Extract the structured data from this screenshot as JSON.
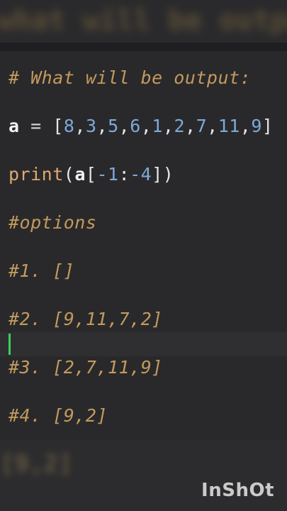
{
  "header": {
    "blurred_title": "what will be output"
  },
  "code": {
    "comment_line": "# What will be output:",
    "list_name": "a",
    "assign_op": "=",
    "list_items": [
      "8",
      "3",
      "5",
      "6",
      "1",
      "2",
      "7",
      "11",
      "9"
    ],
    "print_fn": "print",
    "print_arg_var": "a",
    "slice_start": "-1",
    "slice_end": "-4",
    "options_comment": "#options",
    "option_1": "#1. []",
    "option_2": "#2. [9,11,7,2]",
    "option_3": "#3. [2,7,11,9]",
    "option_4": "#4. [9,2]"
  },
  "footer": {
    "blurred_text": "[9,2]"
  },
  "watermark": "InShOt",
  "colors": {
    "background": "#29292b",
    "comment": "#c39a5e",
    "number": "#7ea9d9",
    "function": "#e0a870",
    "cursor": "#35d35a"
  }
}
